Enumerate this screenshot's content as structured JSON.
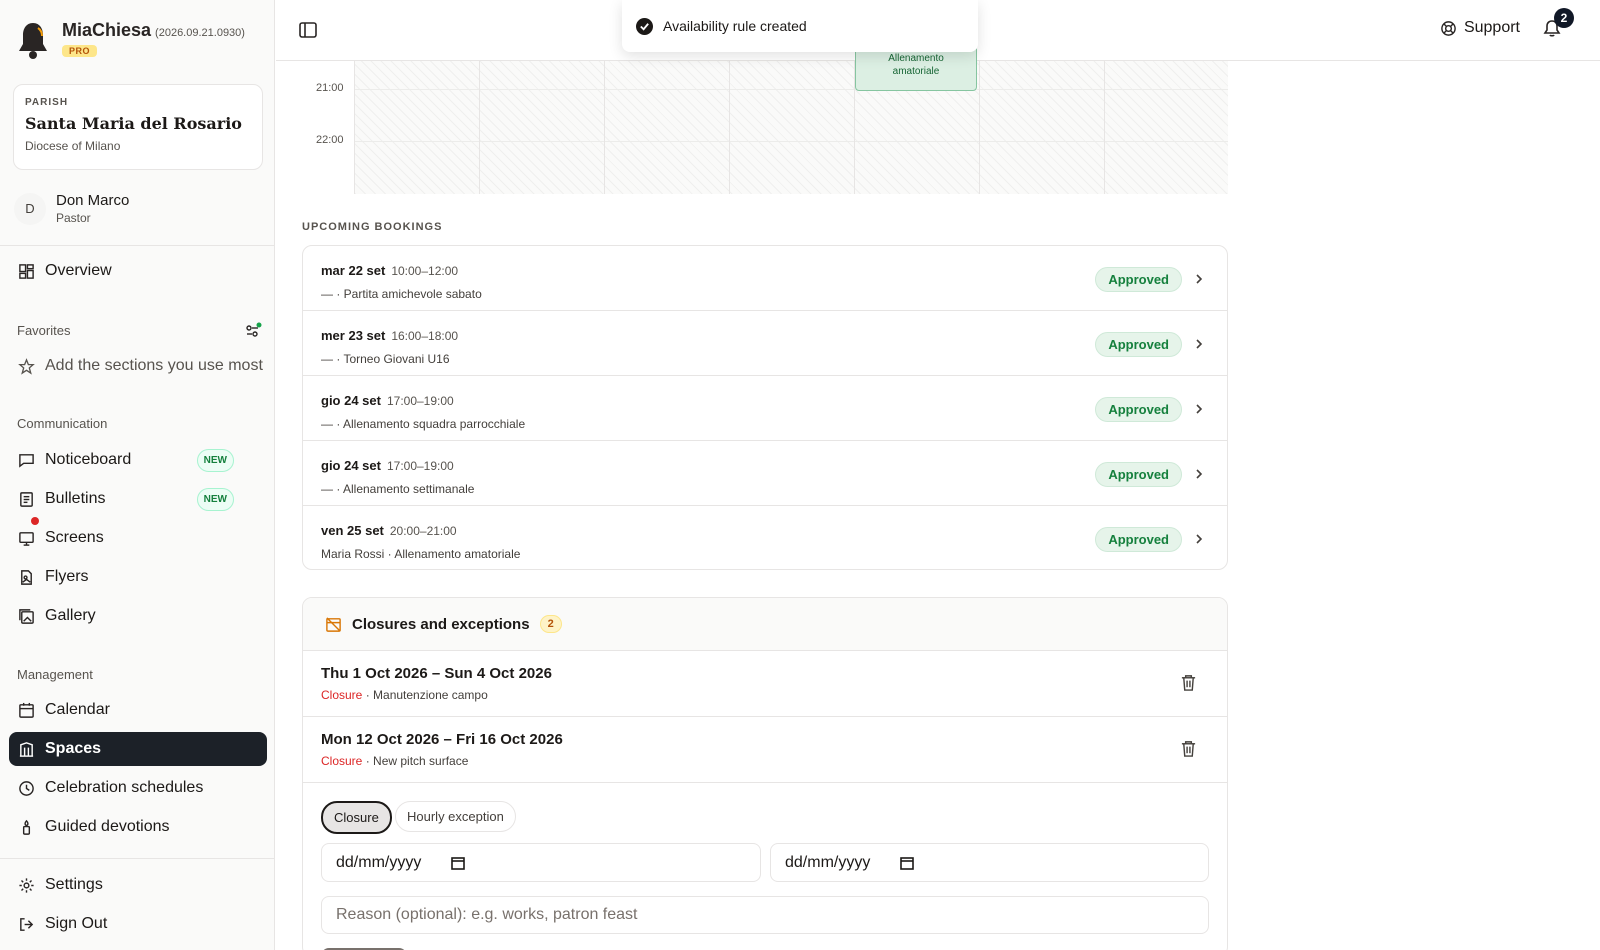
{
  "brand": {
    "name": "MiaChiesa",
    "version": "(2026.09.21.0930)",
    "plan": "PRO"
  },
  "parish": {
    "label": "PARISH",
    "name": "Santa Maria del Rosario",
    "diocese": "Diocese of Milano"
  },
  "user": {
    "initial": "D",
    "name": "Don Marco",
    "role": "Pastor"
  },
  "nav": {
    "overview": "Overview",
    "favorites_title": "Favorites",
    "favorites_placeholder": "Add the sections you use most",
    "communication_title": "Communication",
    "noticeboard": "Noticeboard",
    "bulletins": "Bulletins",
    "screens": "Screens",
    "flyers": "Flyers",
    "gallery": "Gallery",
    "new_badge": "NEW",
    "management_title": "Management",
    "calendar": "Calendar",
    "spaces": "Spaces",
    "celebration_schedules": "Celebration schedules",
    "guided_devotions": "Guided devotions",
    "settings": "Settings",
    "sign_out": "Sign Out"
  },
  "topbar": {
    "support": "Support",
    "notifications_count": "2"
  },
  "toast": {
    "message": "Availability rule created"
  },
  "calendar_grid": {
    "times": [
      "21:00",
      "22:00"
    ],
    "event": {
      "line1": "Allenamento",
      "line2": "amatoriale"
    }
  },
  "upcoming": {
    "title": "UPCOMING BOOKINGS",
    "items": [
      {
        "date": "mar 22 set",
        "time": "10:00–12:00",
        "desc": "— · Partita amichevole sabato",
        "status": "Approved"
      },
      {
        "date": "mer 23 set",
        "time": "16:00–18:00",
        "desc": "— · Torneo Giovani U16",
        "status": "Approved"
      },
      {
        "date": "gio 24 set",
        "time": "17:00–19:00",
        "desc": "— · Allenamento squadra parrocchiale",
        "status": "Approved"
      },
      {
        "date": "gio 24 set",
        "time": "17:00–19:00",
        "desc": "— · Allenamento settimanale",
        "status": "Approved"
      },
      {
        "date": "ven 25 set",
        "time": "20:00–21:00",
        "desc": "Maria Rossi · Allenamento amatoriale",
        "status": "Approved"
      }
    ]
  },
  "closures": {
    "title": "Closures and exceptions",
    "count": "2",
    "items": [
      {
        "range": "Thu 1 Oct 2026 – Sun 4 Oct 2026",
        "type": "Closure",
        "reason": " · Manutenzione campo"
      },
      {
        "range": "Mon 12 Oct 2026 – Fri 16 Oct 2026",
        "type": "Closure",
        "reason": " · New pitch surface"
      }
    ],
    "form": {
      "tab_closure": "Closure",
      "tab_hourly": "Hourly exception",
      "date_from": "dd/mm/yyyy",
      "date_to": "dd/mm/yyyy",
      "reason_placeholder": "Reason (optional): e.g. works, patron feast"
    }
  },
  "colors": {
    "accent_active": "#1c2128",
    "approved": "#15803d",
    "closure": "#dc2626"
  }
}
